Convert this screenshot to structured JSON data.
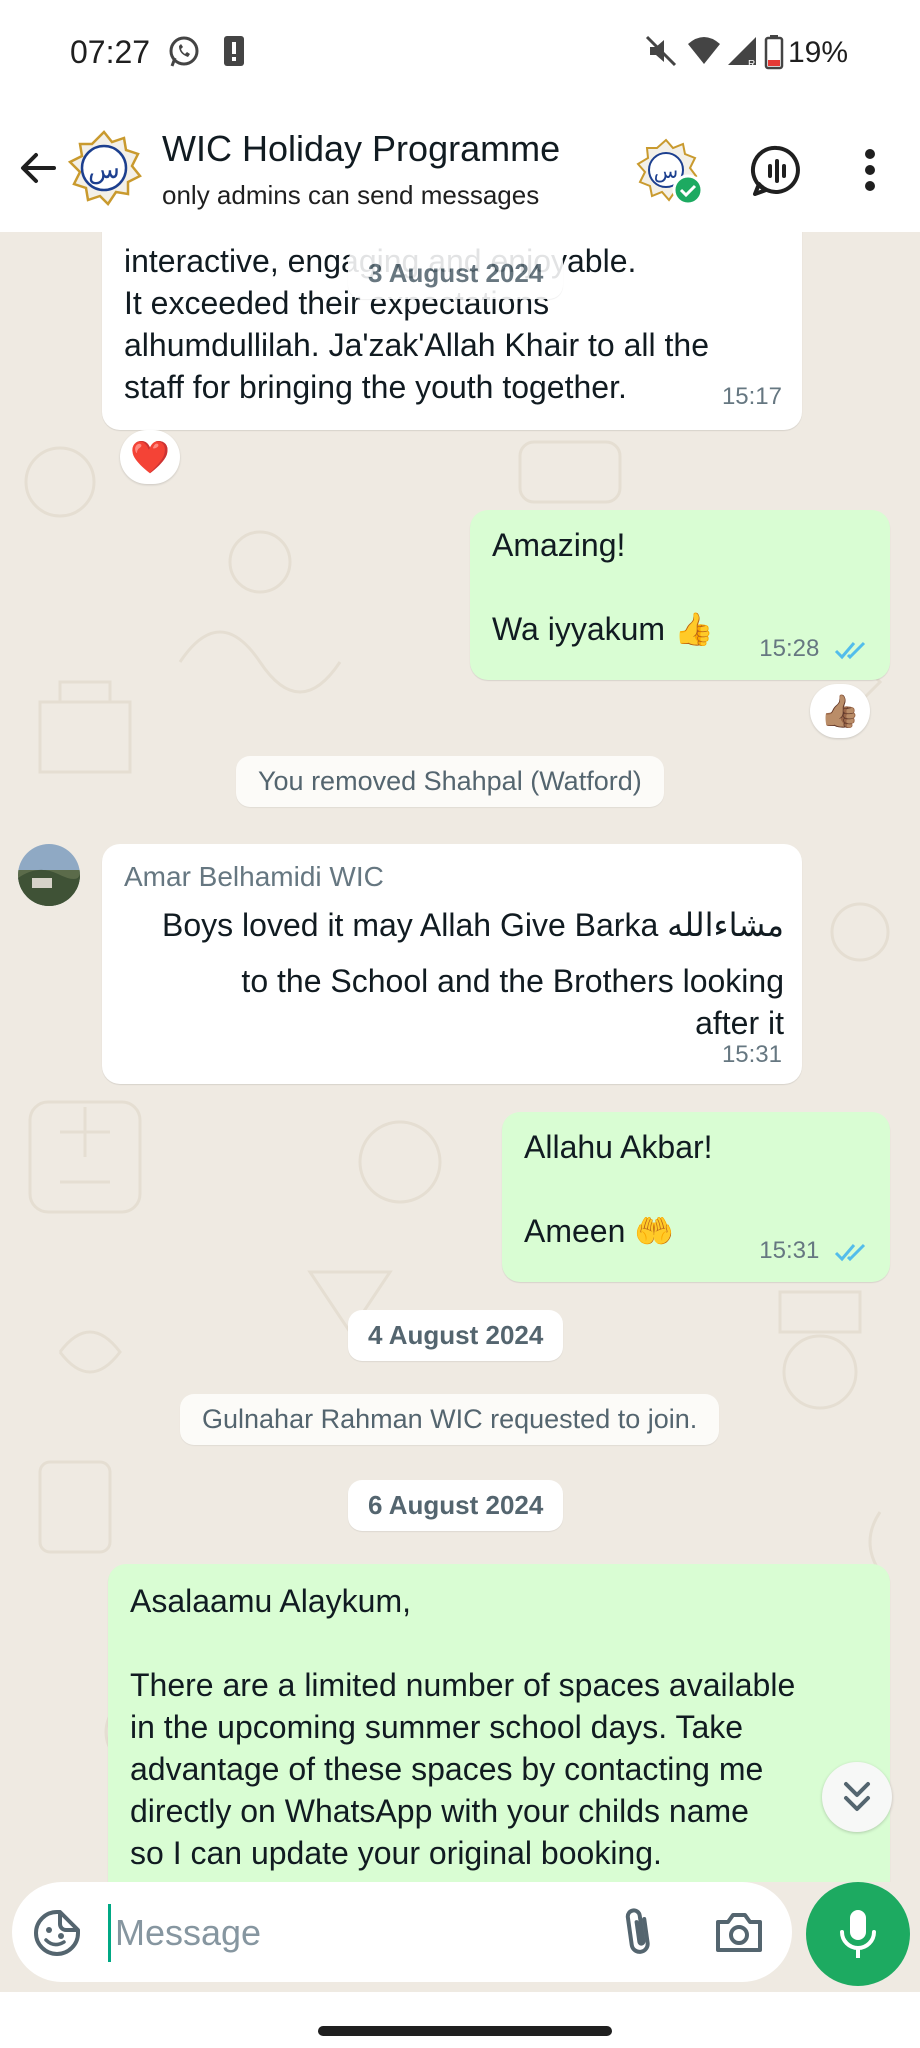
{
  "status_bar": {
    "time": "07:27",
    "battery": "19%"
  },
  "header": {
    "title": "WIC Holiday Programme",
    "subtitle": "only admins can send messages",
    "avatar_letter": "س"
  },
  "chat": {
    "m1": {
      "lines": [
        "interactive, engaging and enjoyable.",
        "It exceeded their expectations",
        "alhumdullilah. Ja'zak'Allah Khair to all the",
        "staff for bringing the youth together."
      ],
      "time": "15:17",
      "reaction": "❤️"
    },
    "floating_date": "3 August 2024",
    "m2": {
      "text": "Amazing!\n\nWa iyyakum 👍",
      "time": "15:28",
      "reaction": "👍🏽"
    },
    "sys1": "You removed Shahpal (Watford)",
    "m3": {
      "sender": "Amar Belhamidi WIC",
      "line1": "Boys loved it may Allah Give Barka مشاءالله",
      "line2": "to the School and the Brothers looking",
      "line3": "after it",
      "time": "15:31"
    },
    "m4": {
      "text": "Allahu Akbar!\n\nAmeen 🤲",
      "time": "15:31"
    },
    "date2": "4 August 2024",
    "sys2": "Gulnahar Rahman WIC requested to join.",
    "date3": "6 August 2024",
    "m5": {
      "text": "Asalaamu Alaykum,\n\nThere are a limited number of spaces available\nin the upcoming summer school days. Take\nadvantage of these spaces by contacting me\ndirectly on WhatsApp with your childs name\nso I can update your original booking."
    }
  },
  "input": {
    "placeholder": "Message"
  },
  "colors": {
    "outgoing_bubble": "#d9fdd3",
    "incoming_bubble": "#ffffff",
    "chat_background": "#efeae2",
    "accent_green": "#1daa61",
    "read_ticks": "#53bdeb"
  },
  "icons": [
    "back-arrow-icon",
    "voice-chat-icon",
    "more-vert-icon",
    "sticker-icon",
    "paperclip-icon",
    "camera-icon",
    "mic-icon",
    "chevron-double-down-icon"
  ]
}
